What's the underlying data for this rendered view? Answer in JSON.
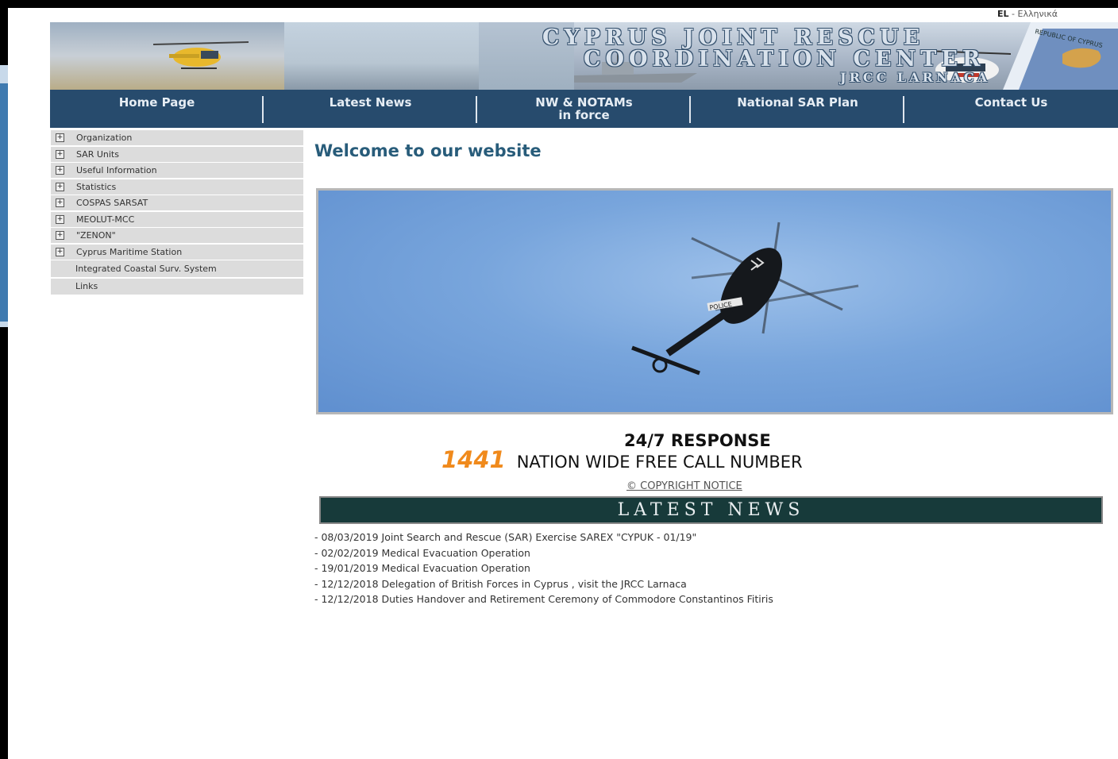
{
  "language": {
    "code": "EL",
    "separator": " - ",
    "label": "Ελληνικά"
  },
  "banner": {
    "title_line1": "CYPRUS JOINT RESCUE",
    "title_line2": "COORDINATION CENTER",
    "title_line3": "JRCC LARNACA",
    "seal_text": "REPUBLIC OF CYPRUS"
  },
  "nav": {
    "items": [
      {
        "label": "Home Page"
      },
      {
        "label": "Latest News"
      },
      {
        "label": "NW & NOTAMs",
        "label2": "in force"
      },
      {
        "label": "National SAR Plan"
      },
      {
        "label": "Contact Us"
      }
    ]
  },
  "sidebar": {
    "items": [
      {
        "label": "Organization",
        "expand": "+"
      },
      {
        "label": "SAR Units",
        "expand": "+"
      },
      {
        "label": "Useful Information",
        "expand": "+"
      },
      {
        "label": "Statistics",
        "expand": "+"
      },
      {
        "label": "COSPAS SARSAT",
        "expand": "+"
      },
      {
        "label": "MEOLUT-MCC",
        "expand": "+"
      },
      {
        "label": "\"ZENON\"",
        "expand": "+"
      },
      {
        "label": "Cyprus Maritime Station",
        "expand": "+"
      },
      {
        "label": "Integrated Coastal Surv. System"
      },
      {
        "label": "Links"
      }
    ]
  },
  "main": {
    "welcome": "Welcome to our website",
    "response": "24/7 RESPONSE",
    "call_number": "1441",
    "call_text": "NATION WIDE FREE CALL NUMBER",
    "copyright": "© COPYRIGHT NOTICE",
    "news_heading": "LATEST NEWS",
    "hero_marking": "POLICE"
  },
  "news": {
    "items": [
      "- 08/03/2019 Joint Search and Rescue (SAR) Exercise SAREX \"CYPUK - 01/19\"",
      "- 02/02/2019 Medical Evacuation Operation",
      "- 19/01/2019 Medical Evacuation Operation",
      "- 12/12/2018 Delegation of British Forces in Cyprus , visit the JRCC Larnaca",
      "- 12/12/2018 Duties Handover and Retirement Ceremony of Commodore Constantinos Fitiris"
    ]
  },
  "colors": {
    "nav_bg": "#274b6d",
    "welcome": "#285c7a",
    "call_number": "#f08a1c",
    "news_head_bg": "#173a3a"
  }
}
